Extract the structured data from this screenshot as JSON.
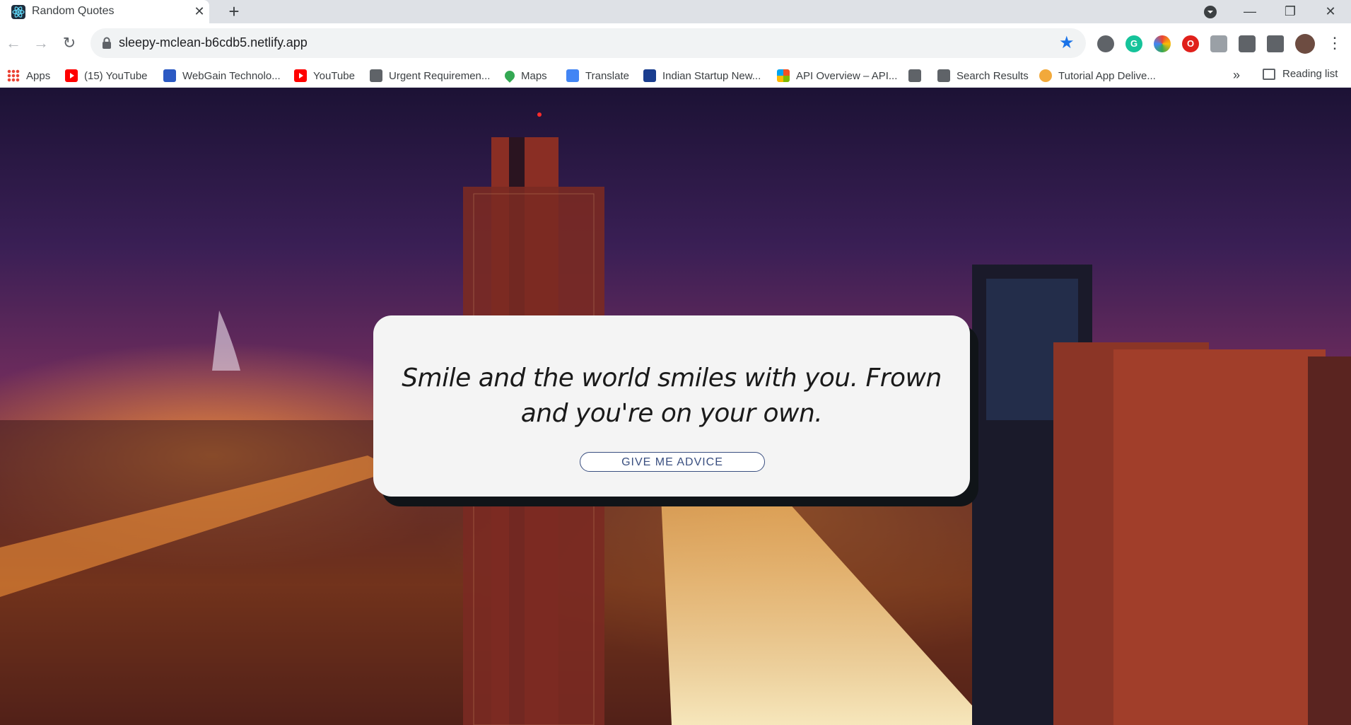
{
  "browser": {
    "tab_title": "Random Quotes",
    "tab_close": "✕",
    "new_tab": "+",
    "url": "sleepy-mclean-b6cdb5.netlify.app",
    "window_controls": {
      "minimize": "—",
      "restore": "❐",
      "close": "✕"
    },
    "nav": {
      "back": "←",
      "forward": "→",
      "reload": "↻"
    },
    "star": "★",
    "menu": "⋮"
  },
  "bookmarks": {
    "items": [
      {
        "label": "Apps",
        "icon": "apps-grid-icon"
      },
      {
        "label": "(15) YouTube",
        "icon": "youtube-icon"
      },
      {
        "label": "WebGain Technolo...",
        "icon": "webgain-icon"
      },
      {
        "label": "YouTube",
        "icon": "youtube-icon"
      },
      {
        "label": "Urgent Requiremen...",
        "icon": "globe-icon"
      },
      {
        "label": "Maps",
        "icon": "maps-pin-icon"
      },
      {
        "label": "Translate",
        "icon": "translate-icon"
      },
      {
        "label": "Indian Startup New...",
        "icon": "isn-icon"
      },
      {
        "label": "API Overview – API...",
        "icon": "microsoft-icon"
      },
      {
        "label": "",
        "icon": "globe-icon"
      },
      {
        "label": "Search Results",
        "icon": "globe-icon"
      },
      {
        "label": "Tutorial App Delive...",
        "icon": "tutorial-icon"
      }
    ],
    "more": "»",
    "reading_list": "Reading list"
  },
  "quote": {
    "text": "Smile and the world smiles with you. Frown and you're on your own.",
    "button_label": "GIVE ME ADVICE"
  },
  "colors": {
    "card_bg": "#f4f4f4",
    "card_shadow": "#101418",
    "button_text": "#3a4f80",
    "star": "#1a73e8"
  }
}
